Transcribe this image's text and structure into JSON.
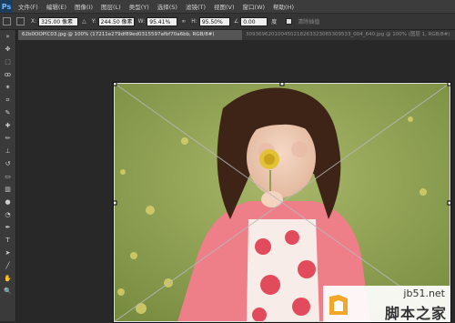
{
  "app": {
    "logo": "Ps"
  },
  "menu": [
    "文件(F)",
    "编辑(E)",
    "图像(I)",
    "图层(L)",
    "类型(Y)",
    "选择(S)",
    "滤镜(T)",
    "视图(V)",
    "窗口(W)",
    "帮助(H)"
  ],
  "options": {
    "x_label": "X:",
    "x_value": "325.00 像素",
    "y_label": "Y:",
    "y_value": "244.50 像素",
    "w_label": "W:",
    "w_value": "95.41%",
    "h_label": "H:",
    "h_value": "95.50%",
    "angle_value": "0.00",
    "angle_unit": "度",
    "interp_label": "清除插值"
  },
  "tabs": {
    "active": "62b0OOPIC03.jpg @ 100% (17211e279df89ed0315597afbf70a6bb, RGB/8#)",
    "inactive": "309369620100450218263323065309533_004_640.jpg @ 100% (图层 1, RGB/8#)"
  },
  "watermark": {
    "url": "jb51.net",
    "text": "脚本之家"
  },
  "colors": {
    "menubar": "#3c3c3c",
    "options_bar": "#353535",
    "toolbar": "#3a3a3a",
    "canvas_bg": "#282828",
    "brand": "#6fb6ff"
  }
}
